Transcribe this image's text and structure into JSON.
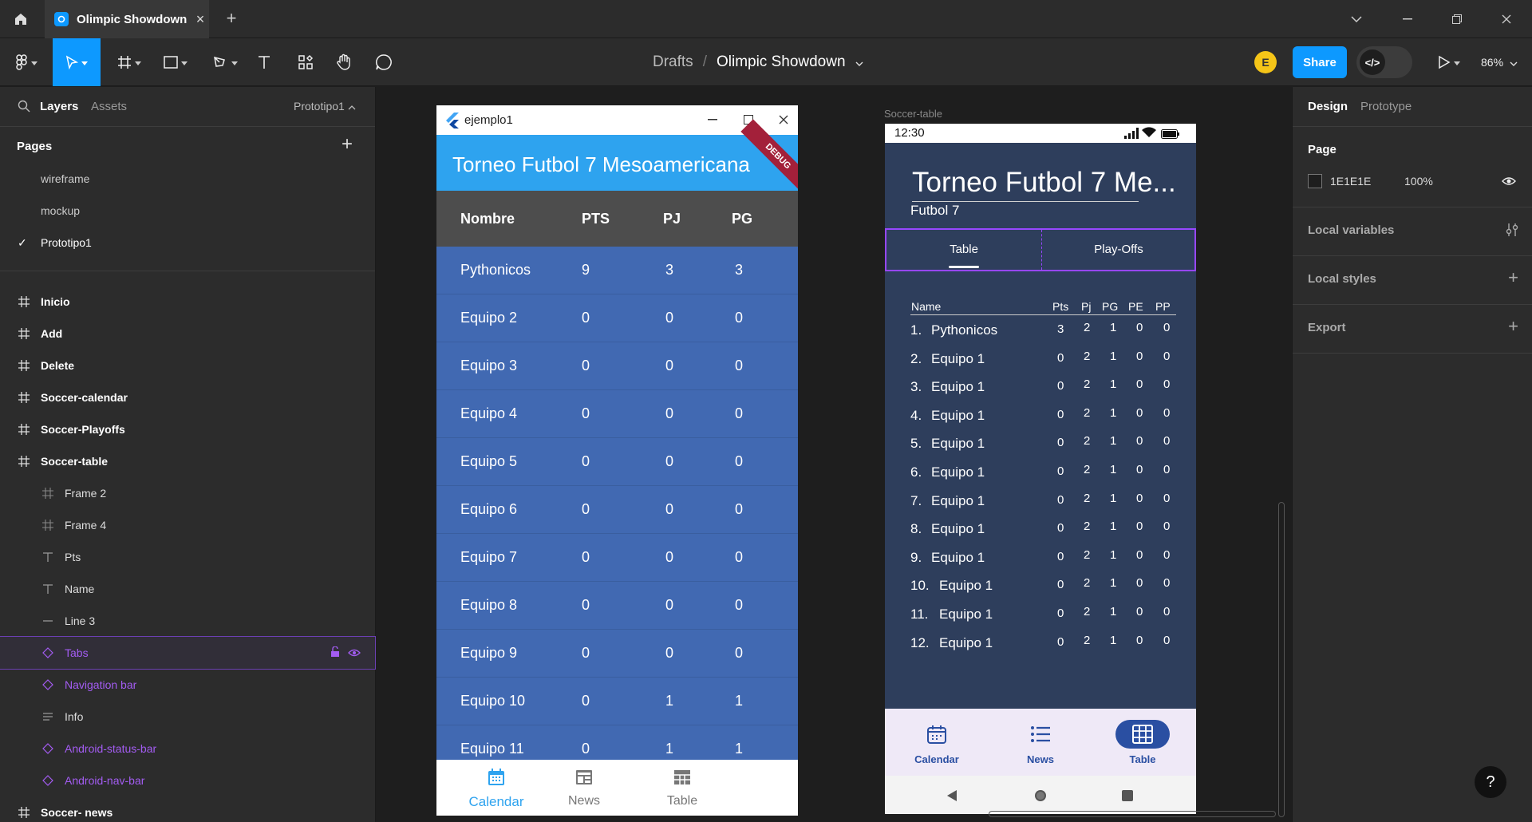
{
  "titlebar": {
    "tab_title": "Olimpic Showdown"
  },
  "toolbar": {
    "breadcrumb_drafts": "Drafts",
    "breadcrumb_sep": "/",
    "file_name": "Olimpic Showdown",
    "avatar_initial": "E",
    "share_label": "Share",
    "dev_mode_label": "</>",
    "zoom": "86%"
  },
  "left_panel": {
    "tab_layers": "Layers",
    "tab_assets": "Assets",
    "current_page": "Prototipo1",
    "pages_header": "Pages",
    "pages": [
      "wireframe",
      "mockup",
      "Prototipo1"
    ],
    "layers": [
      {
        "label": "Inicio",
        "type": "frame"
      },
      {
        "label": "Add",
        "type": "frame"
      },
      {
        "label": "Delete",
        "type": "frame"
      },
      {
        "label": "Soccer-calendar",
        "type": "frame"
      },
      {
        "label": "Soccer-Playoffs",
        "type": "frame"
      },
      {
        "label": "Soccer-table",
        "type": "frame"
      },
      {
        "label": "Frame 2",
        "type": "subframe"
      },
      {
        "label": "Frame 4",
        "type": "subframe"
      },
      {
        "label": "Pts",
        "type": "text"
      },
      {
        "label": "Name",
        "type": "text"
      },
      {
        "label": "Line 3",
        "type": "line"
      },
      {
        "label": "Tabs",
        "type": "component"
      },
      {
        "label": "Navigation bar",
        "type": "component"
      },
      {
        "label": "Info",
        "type": "autolayout"
      },
      {
        "label": "Android-status-bar",
        "type": "component"
      },
      {
        "label": "Android-nav-bar",
        "type": "component"
      },
      {
        "label": "Soccer- news",
        "type": "frame"
      }
    ]
  },
  "desktop_app": {
    "window_title": "ejemplo1",
    "app_title": "Torneo Futbol 7 Mesoamericana",
    "debug_banner": "DEBUG",
    "columns": [
      "Nombre",
      "PTS",
      "PJ",
      "PG"
    ],
    "rows": [
      [
        "Pythonicos",
        "9",
        "3",
        "3"
      ],
      [
        "Equipo 2",
        "0",
        "0",
        "0"
      ],
      [
        "Equipo 3",
        "0",
        "0",
        "0"
      ],
      [
        "Equipo 4",
        "0",
        "0",
        "0"
      ],
      [
        "Equipo 5",
        "0",
        "0",
        "0"
      ],
      [
        "Equipo 6",
        "0",
        "0",
        "0"
      ],
      [
        "Equipo 7",
        "0",
        "0",
        "0"
      ],
      [
        "Equipo 8",
        "0",
        "0",
        "0"
      ],
      [
        "Equipo 9",
        "0",
        "0",
        "0"
      ],
      [
        "Equipo 10",
        "0",
        "1",
        "1"
      ],
      [
        "Equipo 11",
        "0",
        "1",
        "1"
      ]
    ],
    "nav": [
      "Calendar",
      "News",
      "Table"
    ],
    "nav_selected": "Calendar",
    "accent": "#2ea3ef"
  },
  "mobile_frame": {
    "frame_label": "Soccer-table",
    "status_time": "12:30",
    "title": "Torneo Futbol 7 Me...",
    "subtitle": "Futbol 7",
    "tabs": [
      "Table",
      "Play-Offs"
    ],
    "tab_selected": "Table",
    "columns": [
      "Name",
      "Pts",
      "Pj",
      "PG",
      "PE",
      "PP"
    ],
    "rows": [
      [
        "1.",
        "Pythonicos",
        "3",
        "2",
        "1",
        "0",
        "0"
      ],
      [
        "2.",
        "Equipo 1",
        "0",
        "2",
        "1",
        "0",
        "0"
      ],
      [
        "3.",
        "Equipo 1",
        "0",
        "2",
        "1",
        "0",
        "0"
      ],
      [
        "4.",
        "Equipo 1",
        "0",
        "2",
        "1",
        "0",
        "0"
      ],
      [
        "5.",
        "Equipo 1",
        "0",
        "2",
        "1",
        "0",
        "0"
      ],
      [
        "6.",
        "Equipo 1",
        "0",
        "2",
        "1",
        "0",
        "0"
      ],
      [
        "7.",
        "Equipo 1",
        "0",
        "2",
        "1",
        "0",
        "0"
      ],
      [
        "8.",
        "Equipo 1",
        "0",
        "2",
        "1",
        "0",
        "0"
      ],
      [
        "9.",
        "Equipo 1",
        "0",
        "2",
        "1",
        "0",
        "0"
      ],
      [
        "10.",
        "Equipo 1",
        "0",
        "2",
        "1",
        "0",
        "0"
      ],
      [
        "11.",
        "Equipo 1",
        "0",
        "2",
        "1",
        "0",
        "0"
      ],
      [
        "12.",
        "Equipo 1",
        "0",
        "2",
        "1",
        "0",
        "0"
      ]
    ],
    "nav": [
      "Calendar",
      "News",
      "Table"
    ],
    "nav_selected": "Table",
    "accent": "#2a4fa2",
    "selection_color": "#9747ff"
  },
  "right_panel": {
    "tab_design": "Design",
    "tab_prototype": "Prototype",
    "page_header": "Page",
    "page_color": "1E1E1E",
    "page_opacity": "100%",
    "local_variables": "Local variables",
    "local_styles": "Local styles",
    "export": "Export"
  },
  "help": "?"
}
